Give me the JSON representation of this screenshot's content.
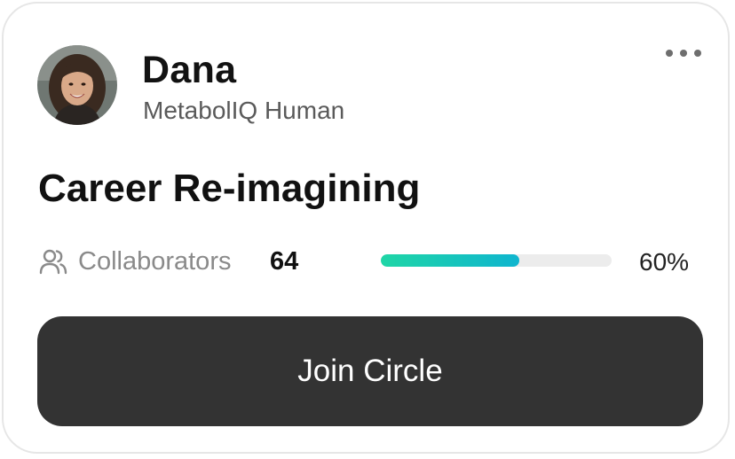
{
  "profile": {
    "name": "Dana",
    "subtitle": "MetabolIQ Human"
  },
  "icons": {
    "avatar": "avatar-photo",
    "menu": "more-horizontal-icon",
    "collaborators": "users-icon"
  },
  "circle": {
    "title": "Career Re-imagining",
    "collaborators_label": "Collaborators",
    "collaborators_count": "64",
    "progress_text": "60%",
    "progress_fraction": 0.6
  },
  "actions": {
    "join_label": "Join Circle"
  },
  "colors": {
    "button_bg": "#333333",
    "progress_start": "#1fd6a6",
    "progress_end": "#0fb5cf",
    "track": "#ececec"
  }
}
